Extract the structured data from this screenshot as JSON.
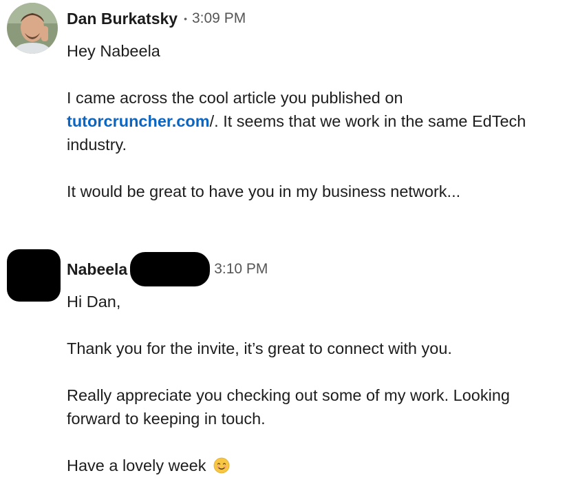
{
  "messages": [
    {
      "sender": "Dan Burkatsky",
      "separator": "•",
      "time": "3:09 PM",
      "greeting": "Hey Nabeela",
      "p1_before": "I came across the cool article you published on",
      "p1_link": "tutorcruncher.com",
      "p1_after": "/. It seems that we work in the same EdTech industry.",
      "p2": "It would be great to have you in my business network..."
    },
    {
      "sender": "Nabeela",
      "time": "3:10 PM",
      "greeting": "Hi Dan,",
      "p1": "Thank you for the invite, it’s great to connect with you.",
      "p2": "Really appreciate you checking out some of my work. Looking forward to keeping in touch.",
      "p3": "Have a lovely week",
      "emoji": "smiling-face-emoji"
    }
  ]
}
